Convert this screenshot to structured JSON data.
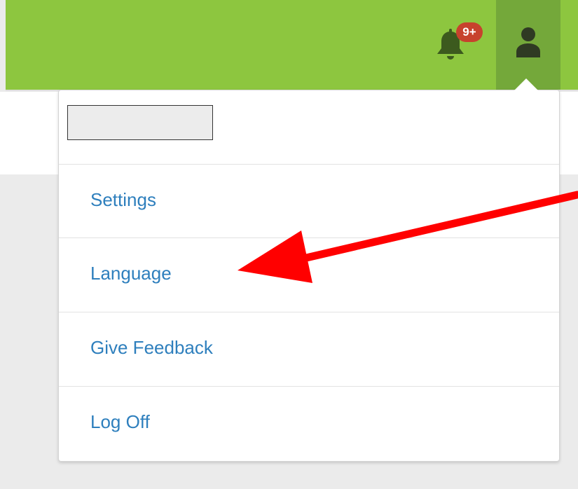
{
  "header": {
    "notifications": {
      "icon": "bell-icon",
      "badge_count": "9+",
      "badge_color": "#c7422d"
    },
    "user_menu": {
      "icon": "user-icon"
    },
    "bar_color": "#8dc63f",
    "active_button_color": "#74a83a"
  },
  "dropdown": {
    "user_name": "",
    "items": [
      {
        "label": "Settings"
      },
      {
        "label": "Language"
      },
      {
        "label": "Give Feedback"
      },
      {
        "label": "Log Off"
      }
    ],
    "link_color": "#2e7fbd"
  },
  "annotation": {
    "type": "arrow",
    "color": "#ff0000",
    "points_to": "Language"
  }
}
